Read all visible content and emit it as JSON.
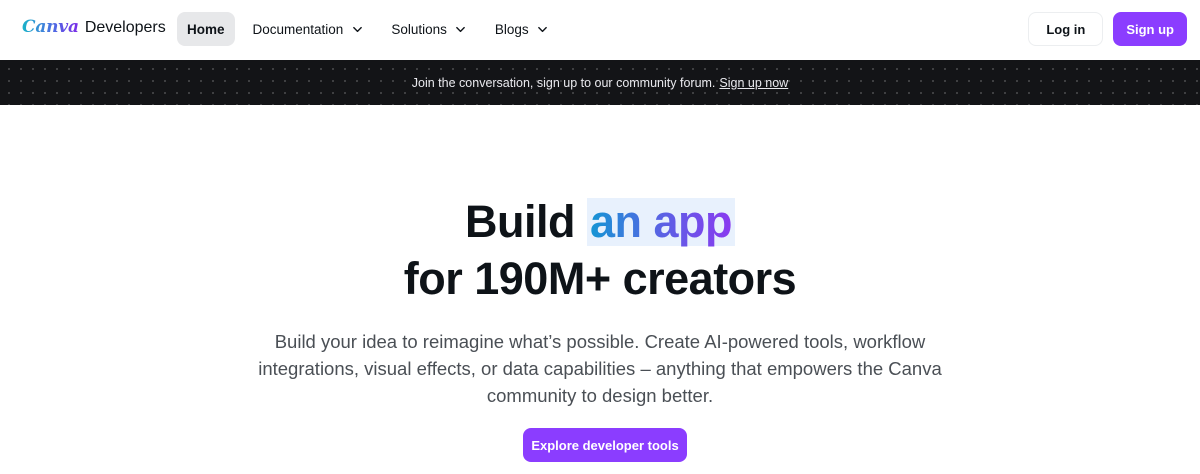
{
  "nav": {
    "brand_logo": "Canva",
    "brand_text": "Developers",
    "links": [
      {
        "label": "Home",
        "active": true
      },
      {
        "label": "Documentation"
      },
      {
        "label": "Solutions"
      },
      {
        "label": "Blogs"
      }
    ],
    "login_label": "Log in",
    "signup_label": "Sign up"
  },
  "banner": {
    "text": "Join the conversation, sign up to our community forum.",
    "link": "Sign up now"
  },
  "hero": {
    "title_start": "Build",
    "title_highlight": "an app",
    "title_line2": "for 190M+ creators",
    "subtitle": "Build your idea to reimagine what’s possible. Create AI-powered tools, workflow integrations, visual effects, or data capabilities – anything that empowers the Canva community to design better.",
    "cta_label": "Explore developer tools"
  },
  "colors": {
    "accent": "#8b3dff",
    "banner_bg": "#131417",
    "nav_active_bg": "#e7e8ea",
    "highlight_bg": "#e8f1fd"
  },
  "icons": {
    "dropdown": "chevron-down-icon"
  }
}
